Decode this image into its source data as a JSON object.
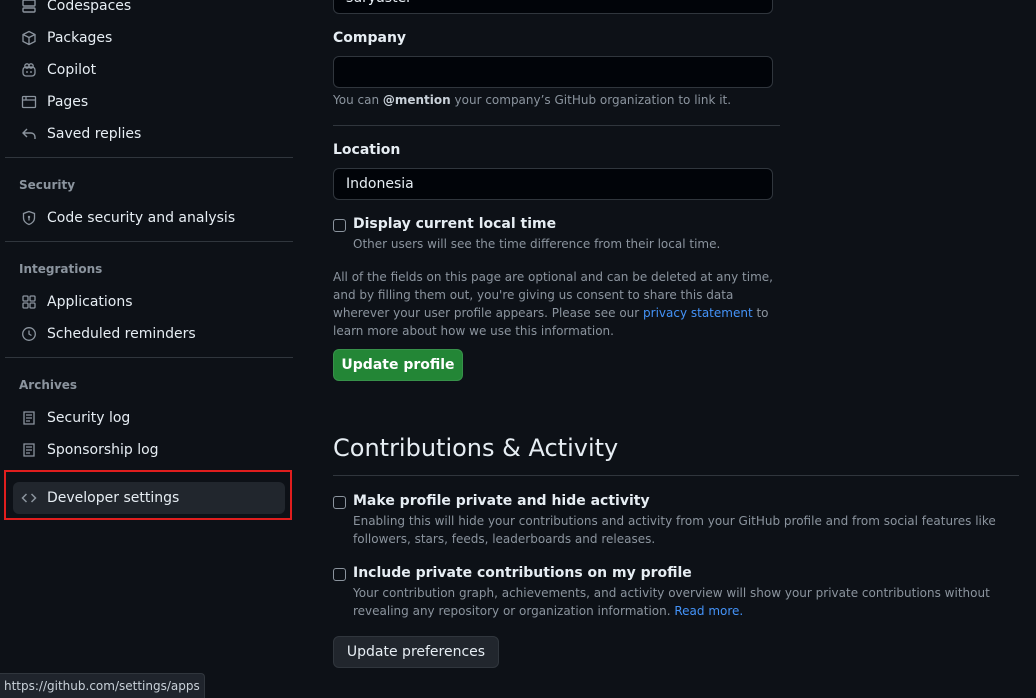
{
  "sidebar": {
    "items_top": [
      {
        "label": "Codespaces",
        "icon": "codespaces-icon"
      },
      {
        "label": "Packages",
        "icon": "package-icon"
      },
      {
        "label": "Copilot",
        "icon": "copilot-icon"
      },
      {
        "label": "Pages",
        "icon": "browser-icon"
      },
      {
        "label": "Saved replies",
        "icon": "reply-icon"
      }
    ],
    "security": {
      "heading": "Security",
      "items": [
        {
          "label": "Code security and analysis",
          "icon": "shield-icon"
        }
      ]
    },
    "integrations": {
      "heading": "Integrations",
      "items": [
        {
          "label": "Applications",
          "icon": "apps-icon"
        },
        {
          "label": "Scheduled reminders",
          "icon": "clock-icon"
        }
      ]
    },
    "archives": {
      "heading": "Archives",
      "items": [
        {
          "label": "Security log",
          "icon": "log-icon"
        },
        {
          "label": "Sponsorship log",
          "icon": "log-icon"
        }
      ]
    },
    "developer_settings": {
      "label": "Developer settings",
      "icon": "code-icon"
    }
  },
  "profile": {
    "previous_field_value": "suryaster",
    "company": {
      "label": "Company",
      "value": "",
      "note_prefix": "You can ",
      "note_mention": "@mention",
      "note_suffix": " your company’s GitHub organization to link it."
    },
    "location": {
      "label": "Location",
      "value": "Indonesia"
    },
    "local_time": {
      "label": "Display current local time",
      "description": "Other users will see the time difference from their local time."
    },
    "disclaimer_prefix": "All of the fields on this page are optional and can be deleted at any time, and by filling them out, you're giving us consent to share this data wherever your user profile appears. Please see our ",
    "disclaimer_link": "privacy statement",
    "disclaimer_suffix": " to learn more about how we use this information.",
    "update_button": "Update profile"
  },
  "contributions": {
    "title": "Contributions & Activity",
    "private": {
      "label": "Make profile private and hide activity",
      "description": "Enabling this will hide your contributions and activity from your GitHub profile and from social features like followers, stars, feeds, leaderboards and releases."
    },
    "include_private": {
      "label": "Include private contributions on my profile",
      "description": "Your contribution graph, achievements, and activity overview will show your private contributions without revealing any repository or organization information. ",
      "read_more": "Read more."
    },
    "update_button": "Update preferences"
  },
  "status_url": "https://github.com/settings/apps",
  "colors": {
    "highlight": "#e01e1e",
    "primary_button": "#238636",
    "link": "#4493f8"
  }
}
